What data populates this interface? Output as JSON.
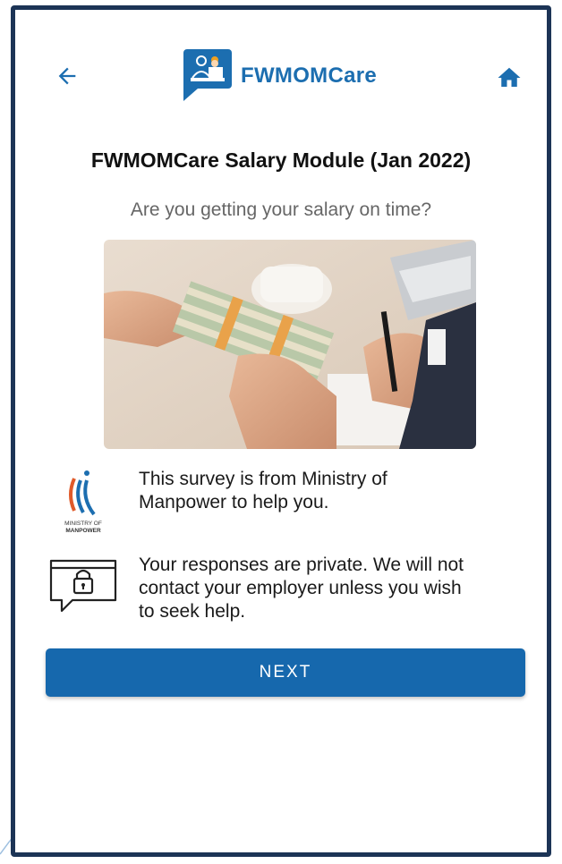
{
  "app": {
    "name": "FWMOMCare",
    "brand_color": "#1c6eb0",
    "accent_color": "#1668ad"
  },
  "header": {
    "back_icon": "arrow-left-icon",
    "home_icon": "home-icon"
  },
  "page": {
    "title": "FWMOMCare Salary Module (Jan 2022)",
    "question": "Are you getting your salary on time?"
  },
  "hero_image": {
    "subject": "cash-handover-photo"
  },
  "info": [
    {
      "icon": "mom-logo-icon",
      "logo_text_line1": "MINISTRY OF",
      "logo_text_line2": "MANPOWER",
      "text_line1": "This survey is from Ministry of",
      "text_line2": "Manpower to help you."
    },
    {
      "icon": "privacy-lock-icon",
      "text_line1": "Your responses are private. We will not",
      "text_line2": "contact your employer unless you wish",
      "text_line3": "to seek help."
    }
  ],
  "actions": {
    "next_label": "NEXT"
  }
}
